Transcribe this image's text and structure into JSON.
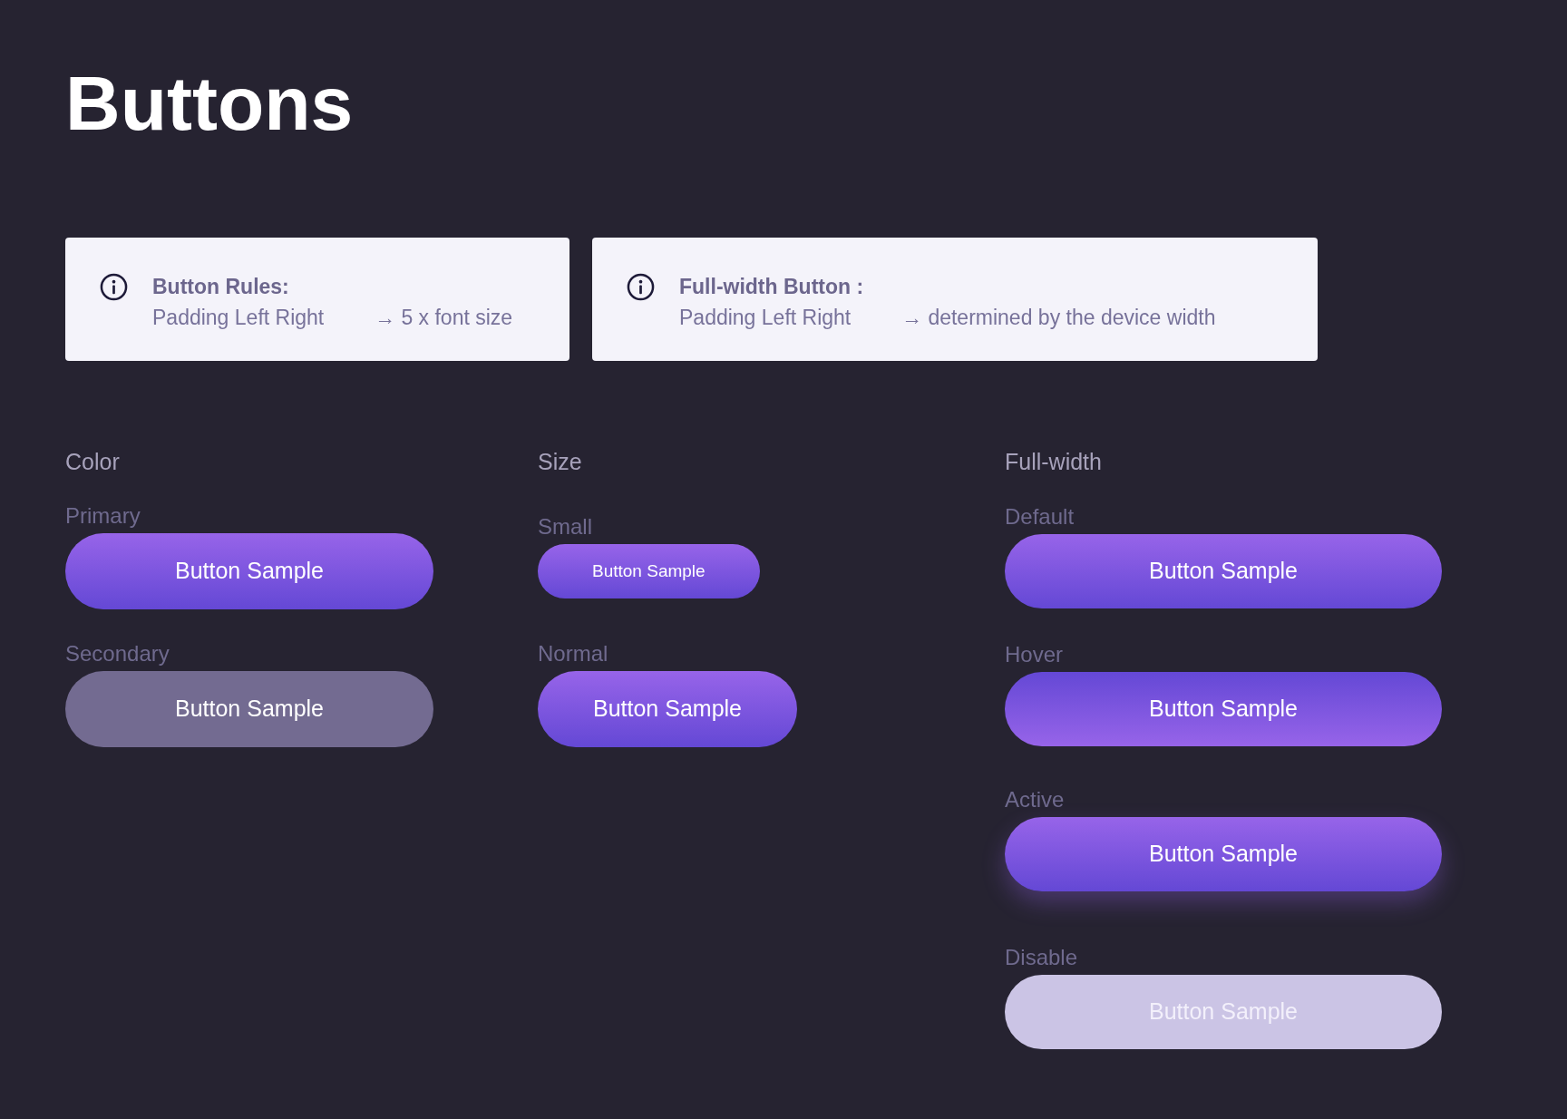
{
  "page": {
    "title": "Buttons"
  },
  "info_cards": [
    {
      "title": "Button Rules:",
      "label": "Padding Left Right",
      "value": "→ 5 x font size"
    },
    {
      "title": "Full-width Button :",
      "label": "Padding Left Right",
      "value": "→ determined by the device width"
    }
  ],
  "sections": [
    {
      "heading": "Color",
      "kind": "fixed",
      "items": [
        {
          "label": "Primary",
          "button": "Button Sample",
          "kind": "primary"
        },
        {
          "label": "Secondary",
          "button": "Button Sample",
          "kind": "secondary"
        }
      ]
    },
    {
      "heading": "Size",
      "kind": "fit",
      "items": [
        {
          "label": "Small",
          "button": "Button Sample",
          "kind": "small"
        },
        {
          "label": "Normal",
          "button": "Button Sample",
          "kind": "primary"
        }
      ]
    },
    {
      "heading": "Full-width",
      "kind": "full",
      "items": [
        {
          "label": "Default",
          "button": "Button Sample",
          "kind": "primary"
        },
        {
          "label": "Hover",
          "button": "Button Sample",
          "kind": "hover"
        },
        {
          "label": "Active",
          "button": "Button Sample",
          "kind": "active"
        },
        {
          "label": "Disable",
          "button": "Button Sample",
          "kind": "disabled"
        }
      ]
    }
  ]
}
